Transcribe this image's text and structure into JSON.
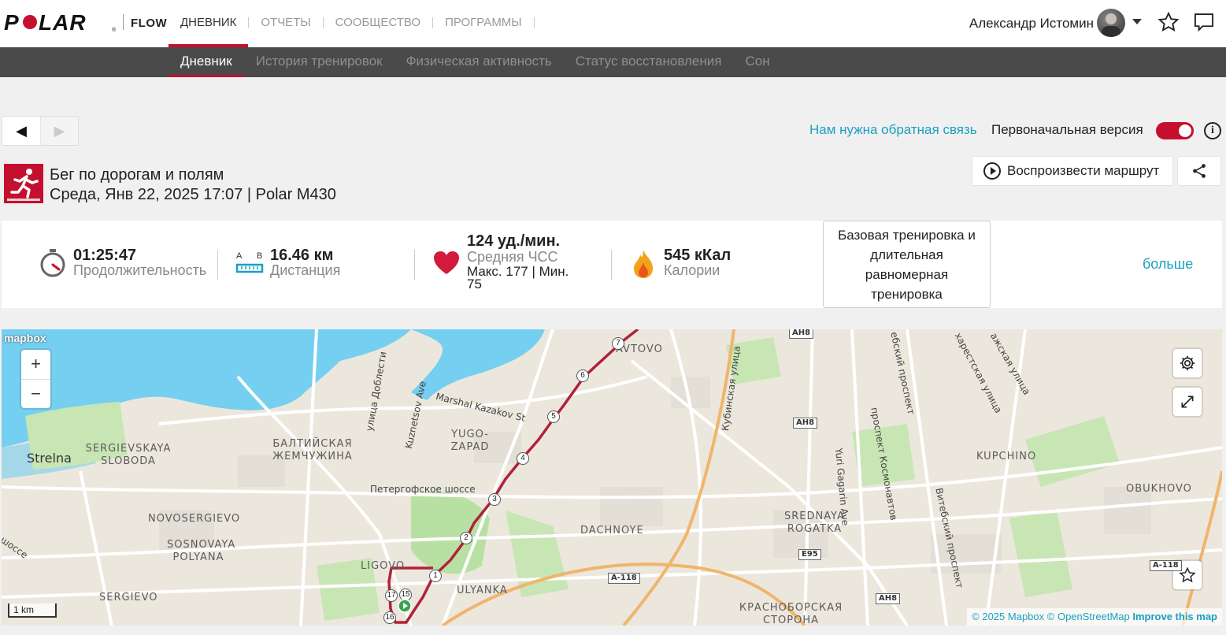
{
  "brand": {
    "logo_text": "POLAR",
    "product": "FLOW"
  },
  "nav": {
    "items": [
      "ДНЕВНИК",
      "ОТЧЕТЫ",
      "СООБЩЕСТВО",
      "ПРОГРАММЫ"
    ],
    "active": "ДНЕВНИК"
  },
  "user": {
    "name": "Александр Истомин"
  },
  "subnav": {
    "items": [
      "Дневник",
      "История тренировок",
      "Физическая активность",
      "Статус восстановления",
      "Сон"
    ],
    "active": "Дневник"
  },
  "feedback": {
    "link": "Нам нужна обратная связь",
    "original_version": "Первоначальная версия",
    "toggle_on": true
  },
  "session": {
    "sport": "Бег по дорогам и полям",
    "datetime": "Среда, Янв 22, 2025 17:07",
    "device": "Polar M430",
    "replay_label": "Воспроизвести маршрут"
  },
  "stats": {
    "duration": {
      "value": "01:25:47",
      "label": "Продолжительность"
    },
    "distance": {
      "ab": "A B",
      "value": "16.46 км",
      "label": "Дистанция"
    },
    "heart_rate": {
      "value": "124 уд./мин.",
      "label": "Средняя ЧСС",
      "max": "Макс. 177",
      "min": "Мин. 75"
    },
    "calories": {
      "value": "545 кКал",
      "label": "Калории"
    },
    "zone_text": "Базовая тренировка и длительная равномерная тренировка",
    "more": "больше"
  },
  "map": {
    "provider_logo": "mapbox",
    "zoom_in": "+",
    "zoom_out": "−",
    "scale": "1 km",
    "attribution": {
      "copyright": "© 2025 Mapbox",
      "osm": "© OpenStreetMap",
      "improve": "Improve this map"
    },
    "labels": [
      "Strelna",
      "SERGIEVSKAYA SLOBODA",
      "БАЛТИЙСКАЯ ЖЕМЧУЖИНА",
      "YUGO-ZAPAD",
      "AVTOVO",
      "Marshal Kazakov St",
      "улица Доблести",
      "Kuznetsov Ave",
      "Петергофское шоссе",
      "NOVOSERGIEVO",
      "SOSNOVAYA POLYANA",
      "LIGOVO",
      "SERGIEVO",
      "ULYANKA",
      "DACHNOYE",
      "Кубинская улица",
      "Yuri Gagarin Ave",
      "проспект Космонавтов",
      "SREDNAYA ROGATKA",
      "Витебский проспект",
      "KUPCHINO",
      "OBUKHOVO",
      "КРАСНОБОРСКАЯ СТОРОНА",
      "ебский проспект",
      "харестская улица",
      "ажская улица",
      "шоссе"
    ],
    "km_markers": [
      "1",
      "2",
      "3",
      "4",
      "5",
      "6",
      "7",
      "15",
      "16",
      "17"
    ],
    "road_shields": [
      "AH8",
      "AH8",
      "AH8",
      "E95",
      "A-118",
      "AH8",
      "A-118"
    ],
    "route_color": "#b0223a"
  },
  "colors": {
    "accent": "#c4102e",
    "link": "#1aa0c2"
  }
}
